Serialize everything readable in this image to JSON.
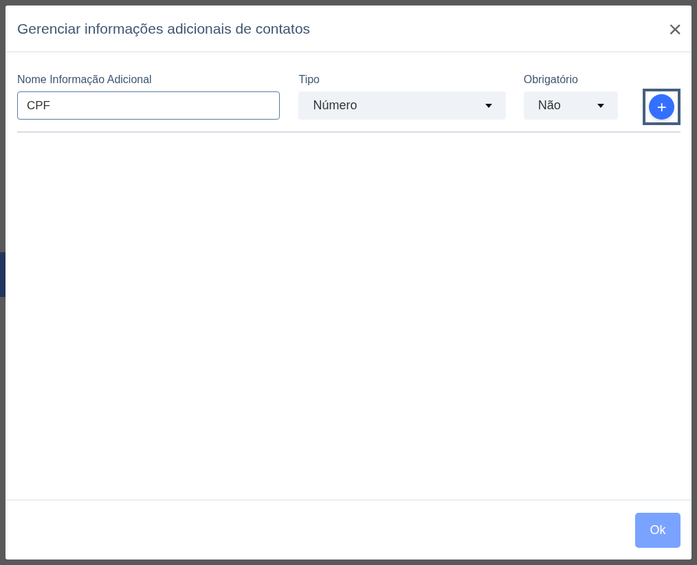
{
  "dialog": {
    "title": "Gerenciar informações adicionais de contatos",
    "close_label": "×"
  },
  "fields": [
    {
      "kind": "text",
      "label": "Nome Informação Adicional",
      "value": "CPF"
    },
    {
      "kind": "select",
      "label": "Tipo",
      "value": "Número"
    },
    {
      "kind": "select",
      "label": "Obrigatório",
      "value": "Não"
    }
  ],
  "add_button": {
    "label": "+",
    "focused": true
  },
  "footer": {
    "ok_button": "Ok"
  }
}
